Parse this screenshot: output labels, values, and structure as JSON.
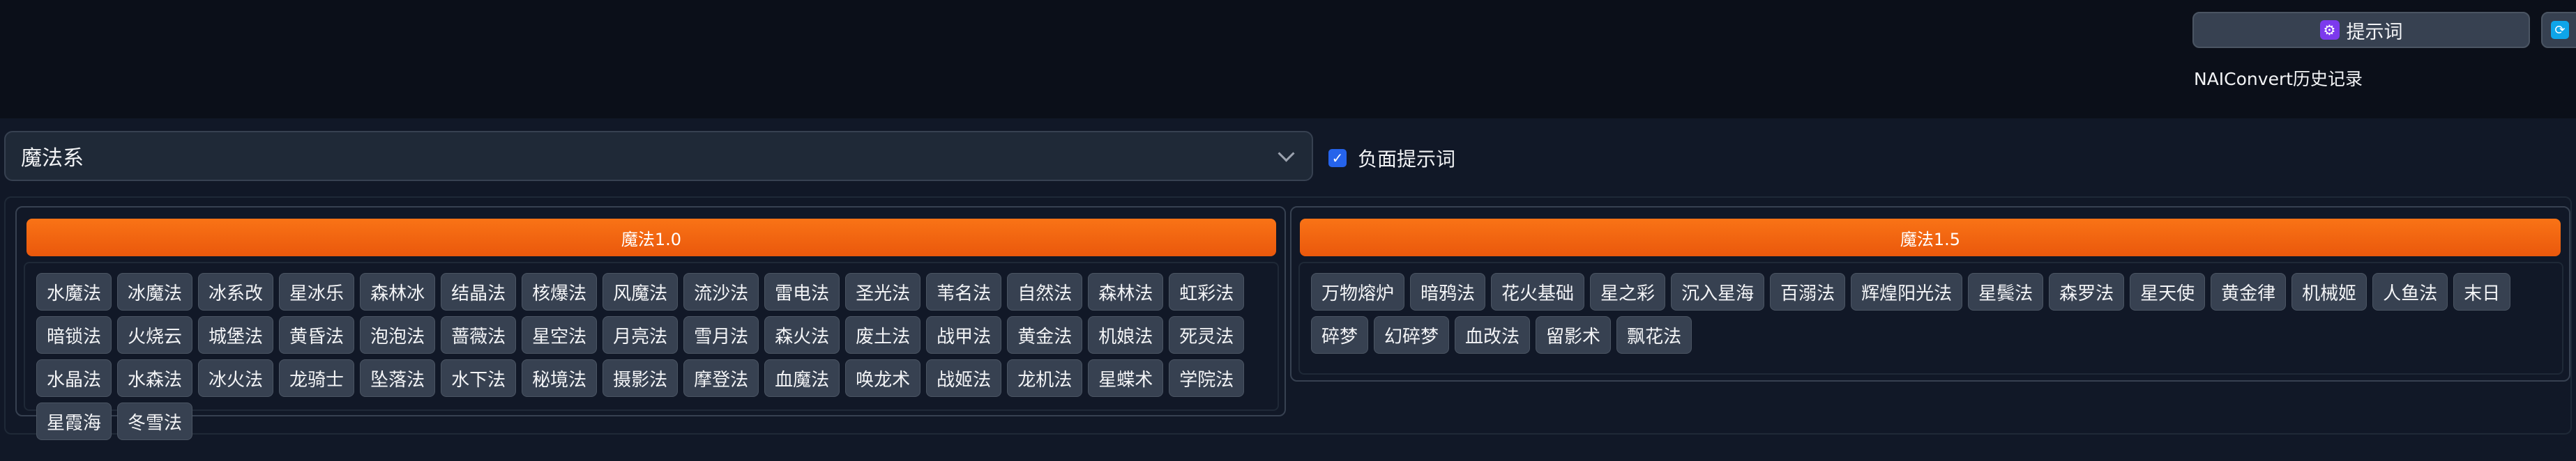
{
  "header": {
    "prompt_button_label": "提示词",
    "history_link": "NAIConvert历史记录"
  },
  "controls": {
    "category_select_value": "魔法系",
    "negative_prompt_label": "负面提示词",
    "negative_prompt_checked": true
  },
  "colors": {
    "accent_orange": "#f97316",
    "background": "#0b0f19",
    "chip_bg": "#374151"
  },
  "panels": [
    {
      "title": "魔法1.0",
      "chips": [
        "水魔法",
        "冰魔法",
        "冰系改",
        "星冰乐",
        "森林冰",
        "结晶法",
        "核爆法",
        "风魔法",
        "流沙法",
        "雷电法",
        "圣光法",
        "苇名法",
        "自然法",
        "森林法",
        "虹彩法",
        "暗锁法",
        "火烧云",
        "城堡法",
        "黄昏法",
        "泡泡法",
        "蔷薇法",
        "星空法",
        "月亮法",
        "雪月法",
        "森火法",
        "废土法",
        "战甲法",
        "黄金法",
        "机娘法",
        "死灵法",
        "水晶法",
        "水森法",
        "冰火法",
        "龙骑士",
        "坠落法",
        "水下法",
        "秘境法",
        "摄影法",
        "摩登法",
        "血魔法",
        "唤龙术",
        "战姬法",
        "龙机法",
        "星蝶术",
        "学院法",
        "星霞海",
        "冬雪法"
      ]
    },
    {
      "title": "魔法1.5",
      "chips": [
        "万物熔炉",
        "暗鸦法",
        "花火基础",
        "星之彩",
        "沉入星海",
        "百溺法",
        "辉煌阳光法",
        "星鬓法",
        "森罗法",
        "星天使",
        "黄金律",
        "机械姬",
        "人鱼法",
        "末日",
        "碎梦",
        "幻碎梦",
        "血改法",
        "留影术",
        "飘花法"
      ]
    }
  ]
}
